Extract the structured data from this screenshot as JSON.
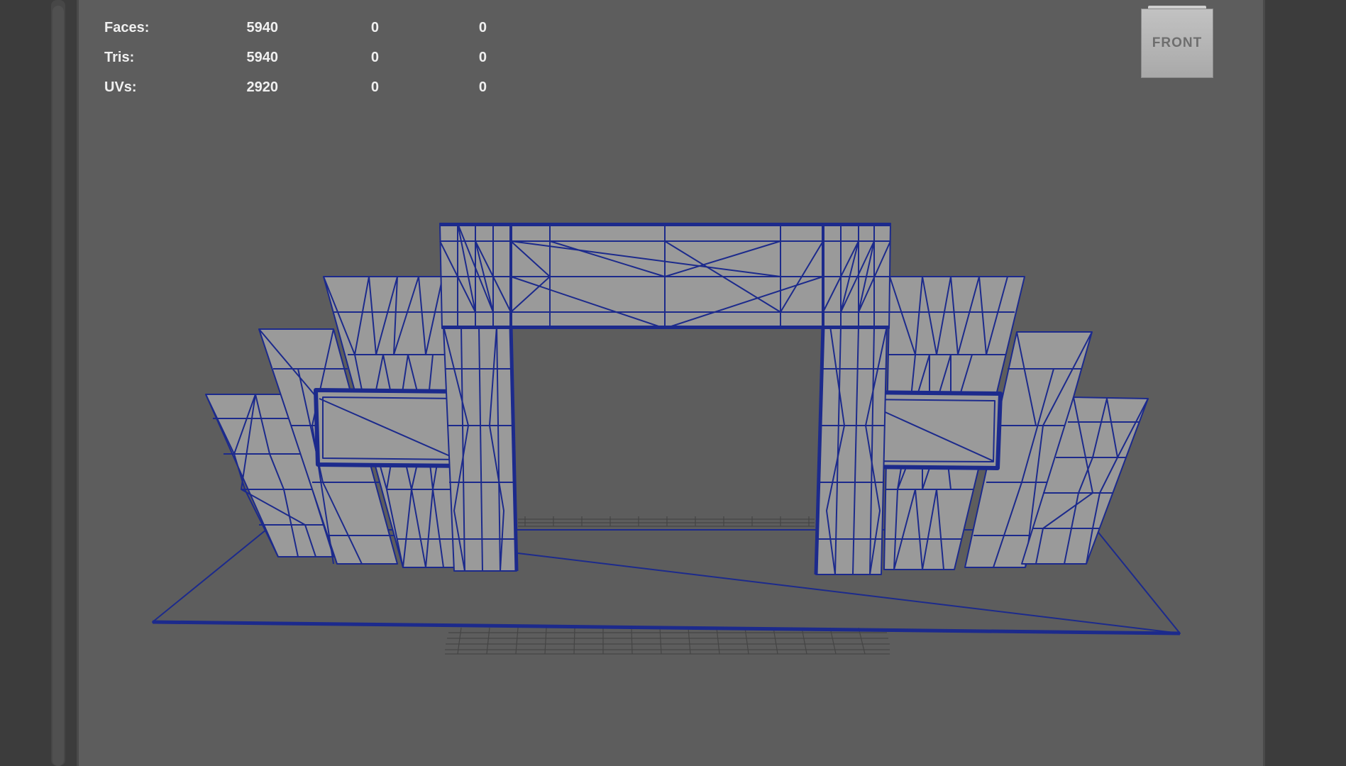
{
  "hud": {
    "faces": {
      "label": "Faces:",
      "values": [
        "5940",
        "0",
        "0"
      ]
    },
    "tris": {
      "label": "Tris:",
      "values": [
        "5940",
        "0",
        "0"
      ]
    },
    "uvs": {
      "label": "UVs:",
      "values": [
        "2920",
        "0",
        "0"
      ]
    }
  },
  "view_cube": {
    "label": "FRONT"
  },
  "colors": {
    "viewport_bg": "#5d5d5d",
    "mesh_fill": "#9a9a9a",
    "wire": "#1c2a8c",
    "grid": "#454545"
  },
  "icons": {
    "view_cube": "view-cube-icon"
  }
}
